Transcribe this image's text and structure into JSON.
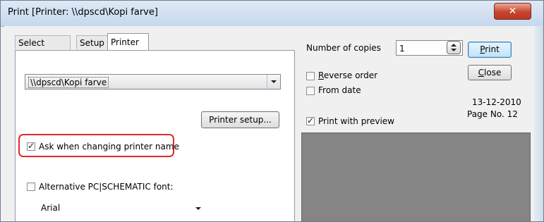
{
  "window": {
    "title": "Print [Printer: \\\\dpscd\\Kopi farve]",
    "close_glyph": "✕"
  },
  "tabs": [
    {
      "label": "Select pages"
    },
    {
      "label": "Setup"
    },
    {
      "label": "Printer"
    }
  ],
  "printer_tab": {
    "printer_select_value": "\\\\dpscd\\Kopi farve",
    "printer_setup_label": "Printer setup...",
    "ask_when_changing_label": "Ask when changing printer name",
    "ask_when_changing_checked": true,
    "alt_font_label": "Alternative PC|SCHEMATIC font:",
    "alt_font_checked": false,
    "font_value": "Arial"
  },
  "options": {
    "copies_label": "Number of copies",
    "copies_value": "1",
    "reverse_order_label_u": "R",
    "reverse_order_label_rest": "everse order",
    "reverse_order_checked": false,
    "from_date_label": "From date",
    "from_date_checked": false,
    "print_preview_label": "Print with preview",
    "print_preview_checked": true
  },
  "buttons": {
    "print_u": "P",
    "print_rest": "rint",
    "close_u": "C",
    "close_rest": "lose"
  },
  "info": {
    "date": "13-12-2010",
    "page": "Page No. 12"
  },
  "colors": {
    "highlight": "#e02a2a",
    "preview_bg": "#858585"
  }
}
